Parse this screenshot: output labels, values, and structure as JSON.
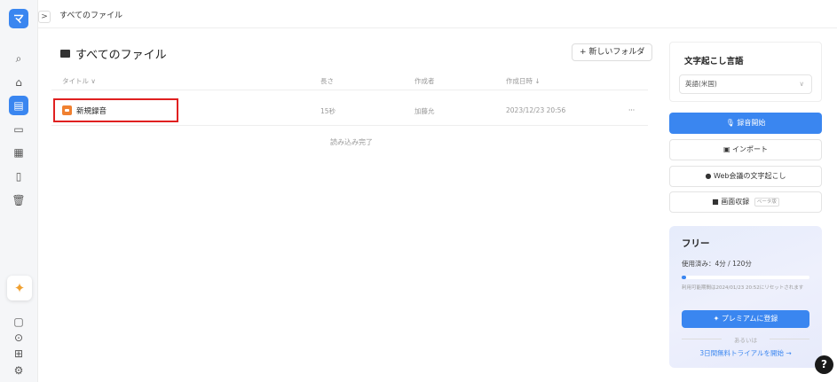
{
  "nav": {
    "logo": "マ",
    "collapse": ">",
    "icons": [
      {
        "name": "search-icon",
        "glyph": "⌕"
      },
      {
        "name": "home-icon",
        "glyph": "⌂"
      },
      {
        "name": "files-icon",
        "glyph": "▤"
      },
      {
        "name": "folder-icon",
        "glyph": "▭"
      },
      {
        "name": "calendar-icon",
        "glyph": "▦"
      },
      {
        "name": "document-icon",
        "glyph": "▯"
      },
      {
        "name": "trash-icon",
        "glyph": "🗑"
      }
    ],
    "bottom_icons": [
      {
        "name": "feedback-icon",
        "glyph": "▢"
      },
      {
        "name": "location-icon",
        "glyph": "⊙"
      },
      {
        "name": "gift-icon",
        "glyph": "⊞"
      },
      {
        "name": "settings-icon",
        "glyph": "⚙"
      }
    ],
    "spark_glyph": "✦"
  },
  "breadcrumb": "すべてのファイル",
  "main": {
    "title": "すべてのファイル",
    "new_folder": "+ 新しいフォルダ",
    "columns": {
      "title": "タイトル ∨",
      "length": "長さ",
      "creator": "作成者",
      "date": "作成日時 ↓"
    },
    "rows": [
      {
        "name": "新規録音",
        "length": "15秒",
        "creator": "加藤允",
        "date": "2023/12/23 20:56",
        "more": "···"
      }
    ],
    "loaded": "読み込み完了"
  },
  "panel": {
    "lang_heading": "文字起こし言語",
    "lang_value": "英語(米国)",
    "lang_chevron": "∨",
    "record": "🎙 録音開始",
    "import": "▣ インポート",
    "web_meeting": "● Web会議の文字起こし",
    "screen_record": "■ 画面収録",
    "screen_record_tag": "ベータ版"
  },
  "promo": {
    "plan": "フリー",
    "used": "使用済み：4分 / 120分",
    "usage_fraction": 0.033,
    "note": "利用可能期間は2024/01/23 20:52にリセットされます",
    "cta": "✦ プレミアムに登録",
    "or": "あるいは",
    "trial": "3日間無料トライアルを開始 →"
  },
  "help": "?"
}
